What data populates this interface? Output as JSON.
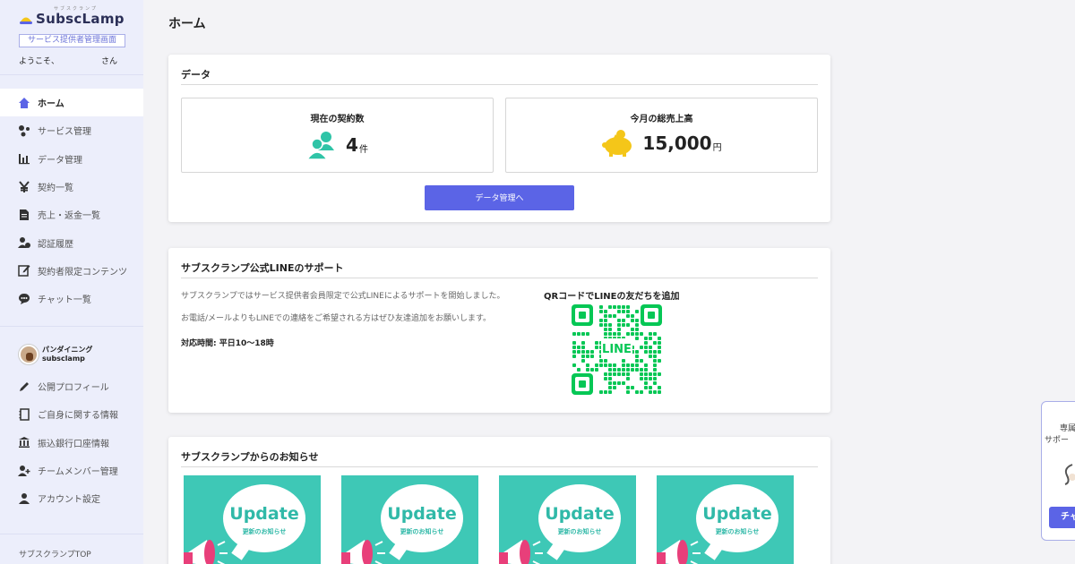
{
  "brand": {
    "name": "SubscLamp",
    "ruby": "サブスクランプ",
    "admin_label": "サービス提供者管理画面",
    "welcome_prefix": "ようこそ、",
    "welcome_suffix": "さん"
  },
  "sidebar": {
    "main_menu": [
      {
        "label": "ホーム",
        "icon": "home-icon",
        "active": true
      },
      {
        "label": "サービス管理",
        "icon": "services-icon"
      },
      {
        "label": "データ管理",
        "icon": "bar-chart-icon"
      },
      {
        "label": "契約一覧",
        "icon": "yen-icon"
      },
      {
        "label": "売上・返金一覧",
        "icon": "document-icon"
      },
      {
        "label": "認証履歴",
        "icon": "user-check-icon"
      },
      {
        "label": "契約者限定コンテンツ",
        "icon": "edit-icon"
      },
      {
        "label": "チャット一覧",
        "icon": "chat-icon"
      }
    ],
    "profile": {
      "name": "パンダイニング",
      "id": "subsclamp"
    },
    "account_menu": [
      {
        "label": "公開プロフィール",
        "icon": "pencil-icon"
      },
      {
        "label": "ご自身に関する情報",
        "icon": "id-card-icon"
      },
      {
        "label": "振込銀行口座情報",
        "icon": "bank-icon"
      },
      {
        "label": "チームメンバー管理",
        "icon": "user-add-icon"
      },
      {
        "label": "アカウント設定",
        "icon": "user-icon"
      }
    ],
    "bottom_link": "サブスクランプTOP"
  },
  "main": {
    "page_title": "ホーム",
    "data_card": {
      "title": "データ",
      "contracts": {
        "label": "現在の契約数",
        "value": "4",
        "unit": "件"
      },
      "sales": {
        "label": "今月の総売上高",
        "value": "15,000",
        "unit": "円"
      },
      "button": "データ管理へ"
    },
    "line_card": {
      "title": "サブスクランプ公式LINEのサポート",
      "text1": "サブスクランプではサービス提供者会員限定で公式LINEによるサポートを開始しました。",
      "text2": "お電話/メールよりもLINEでの連絡をご希望される方はぜひ友達追加をお願いします。",
      "hours": "対応時間: 平日10〜18時",
      "qr_title": "QRコードでLINEの友だちを追加",
      "qr_center": "LINE"
    },
    "news_card": {
      "title": "サブスクランプからのお知らせ",
      "items": [
        {
          "headline": "Update",
          "sub": "更新のお知らせ"
        },
        {
          "headline": "Update",
          "sub": "更新のお知らせ"
        },
        {
          "headline": "Update",
          "sub": "更新のお知らせ"
        },
        {
          "headline": "Update",
          "sub": "更新のお知らせ"
        }
      ]
    }
  },
  "widget": {
    "line1": "専属",
    "line2": "サポー",
    "button": "チャ"
  },
  "colors": {
    "accent": "#5b64e6",
    "sidebar_bg": "#eceefb",
    "teal": "#3ec8b6",
    "line_green": "#06c755",
    "coin_yellow": "#f4c619"
  }
}
